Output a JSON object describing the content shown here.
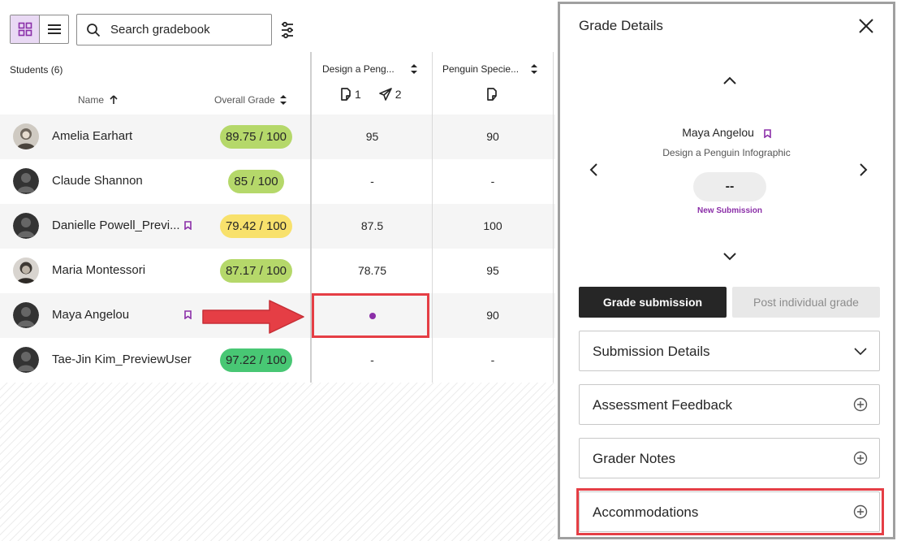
{
  "toolbar": {
    "search_placeholder": "Search gradebook",
    "grid_view_icon": "grid-icon",
    "list_view_icon": "list-icon",
    "filter_icon": "filter-icon"
  },
  "grid": {
    "students_count_label": "Students (6)",
    "name_header": "Name",
    "overall_grade_header": "Overall Grade",
    "columns": [
      {
        "title": "Design a Peng...",
        "submissions_count": "1",
        "sent_count": "2"
      },
      {
        "title": "Penguin Specie..."
      }
    ],
    "rows": [
      {
        "name": "Amelia Earhart",
        "overall": "89.75 / 100",
        "pill_color": "#b5d86a",
        "col1": "95",
        "col2": "90",
        "flag": false,
        "avatar": "photo"
      },
      {
        "name": "Claude Shannon",
        "overall": "85 / 100",
        "pill_color": "#b5d86a",
        "col1": "-",
        "col2": "-",
        "flag": false,
        "avatar": "silhouette"
      },
      {
        "name": "Danielle Powell_Previ...",
        "overall": "79.42 / 100",
        "pill_color": "#f8e16c",
        "col1": "87.5",
        "col2": "100",
        "flag": true,
        "avatar": "silhouette"
      },
      {
        "name": "Maria Montessori",
        "overall": "87.17 / 100",
        "pill_color": "#b5d86a",
        "col1": "78.75",
        "col2": "95",
        "flag": false,
        "avatar": "photo"
      },
      {
        "name": "Maya Angelou",
        "overall": "",
        "pill_color": "",
        "col1": "",
        "col2": "90",
        "flag": true,
        "avatar": "silhouette",
        "col1_new_submission_dot": true
      },
      {
        "name": "Tae-Jin Kim_PreviewUser",
        "overall": "97.22 / 100",
        "pill_color": "#48c774",
        "col1": "-",
        "col2": "-",
        "flag": false,
        "avatar": "silhouette"
      }
    ]
  },
  "panel": {
    "title": "Grade Details",
    "student_name": "Maya Angelou",
    "assignment_name": "Design a Penguin Infographic",
    "grade_value": "--",
    "status": "New Submission",
    "grade_button": "Grade submission",
    "post_button": "Post individual grade",
    "sections": [
      {
        "label": "Submission Details",
        "icon": "chevron-down-icon"
      },
      {
        "label": "Assessment Feedback",
        "icon": "plus-circle-icon"
      },
      {
        "label": "Grader Notes",
        "icon": "plus-circle-icon"
      },
      {
        "label": "Accommodations",
        "icon": "plus-circle-icon"
      }
    ]
  },
  "colors": {
    "accent_purple": "#8b2fa8",
    "highlight_red": "#e53e45",
    "grade_green": "#b5d86a",
    "grade_yellow": "#f8e16c",
    "grade_bright_green": "#48c774"
  }
}
